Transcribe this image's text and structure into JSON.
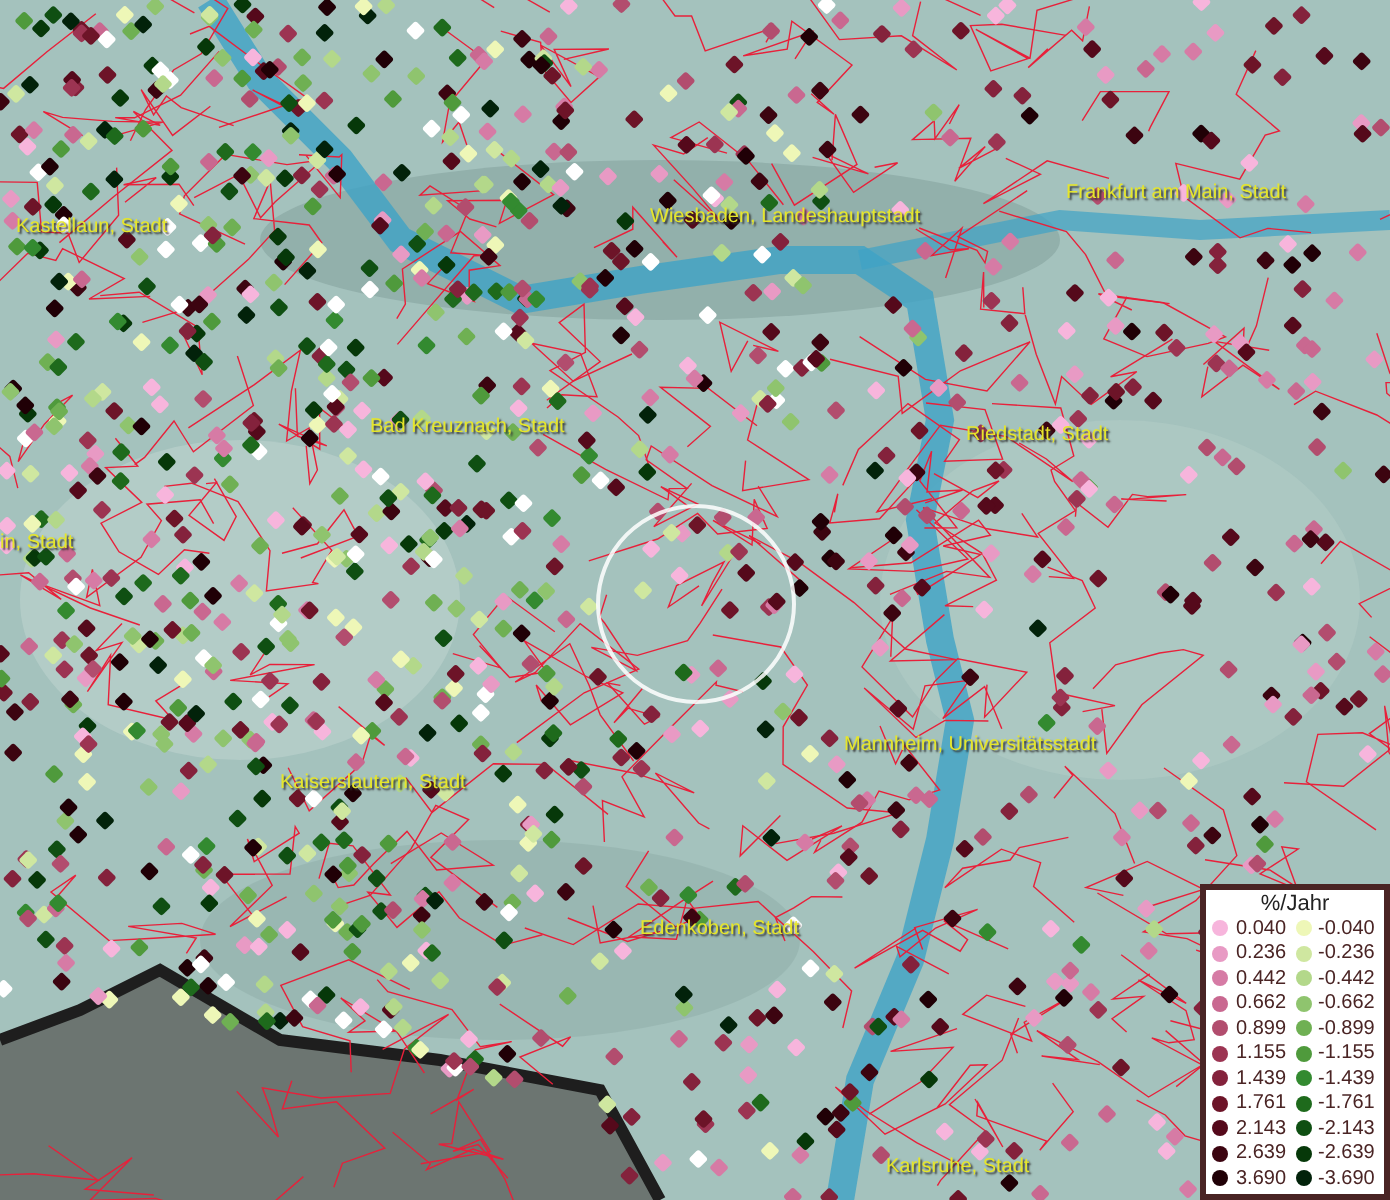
{
  "map": {
    "place_labels": [
      {
        "label": "Kastellaun, Stadt"
      },
      {
        "label": "Wiesbaden, Landeshauptstadt"
      },
      {
        "label": "Frankfurt am Main, Stadt"
      },
      {
        "label": "Bad Kreuznach, Stadt"
      },
      {
        "label": "Riedstadt, Stadt"
      },
      {
        "label": "in, Stadt"
      },
      {
        "label": "Mannheim, Universitätsstadt"
      },
      {
        "label": "Kaiserslautern, Stadt"
      },
      {
        "label": "Edenkoben, Stadt"
      },
      {
        "label": "Karlsruhe, Stadt"
      }
    ]
  },
  "legend": {
    "title": "%/Jahr",
    "rows": [
      {
        "positive": {
          "value": "0.040",
          "color": "#f7b5dc"
        },
        "negative": {
          "value": "-0.040",
          "color": "#eef7b7"
        }
      },
      {
        "positive": {
          "value": "0.236",
          "color": "#e89ac4"
        },
        "negative": {
          "value": "-0.236",
          "color": "#cfe7a0"
        }
      },
      {
        "positive": {
          "value": "0.442",
          "color": "#d67ba5"
        },
        "negative": {
          "value": "-0.442",
          "color": "#b3d88a"
        }
      },
      {
        "positive": {
          "value": "0.662",
          "color": "#c96890"
        },
        "negative": {
          "value": "-0.662",
          "color": "#8fc46e"
        }
      },
      {
        "positive": {
          "value": "0.899",
          "color": "#b24d6e"
        },
        "negative": {
          "value": "-0.899",
          "color": "#6fb053"
        }
      },
      {
        "positive": {
          "value": "1.155",
          "color": "#9c3452"
        },
        "negative": {
          "value": "-1.155",
          "color": "#4f9a3c"
        }
      },
      {
        "positive": {
          "value": "1.439",
          "color": "#84223c"
        },
        "negative": {
          "value": "-1.439",
          "color": "#338a30"
        }
      },
      {
        "positive": {
          "value": "1.761",
          "color": "#6d1428"
        },
        "negative": {
          "value": "-1.761",
          "color": "#1e6a1c"
        }
      },
      {
        "positive": {
          "value": "2.143",
          "color": "#55091b"
        },
        "negative": {
          "value": "-2.143",
          "color": "#0f4f12"
        }
      },
      {
        "positive": {
          "value": "2.639",
          "color": "#3c0410"
        },
        "negative": {
          "value": "-2.639",
          "color": "#063809"
        }
      },
      {
        "positive": {
          "value": "3.690",
          "color": "#200006"
        },
        "negative": {
          "value": "-3.690",
          "color": "#02220a"
        }
      }
    ]
  }
}
